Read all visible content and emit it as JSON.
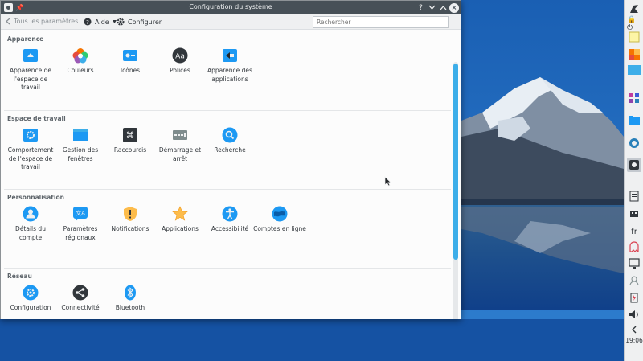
{
  "window": {
    "title": "Configuration du système"
  },
  "toolbar": {
    "back_label": "Tous les paramètres",
    "help_label": "Aide",
    "configure_label": "Configurer",
    "search_placeholder": "Rechercher"
  },
  "sections": [
    {
      "title": "Apparence",
      "items": [
        {
          "label": "Apparence de l'espace de travail",
          "icon": "workspace-appearance-icon"
        },
        {
          "label": "Couleurs",
          "icon": "colors-icon"
        },
        {
          "label": "Icônes",
          "icon": "icons-icon"
        },
        {
          "label": "Polices",
          "icon": "fonts-icon"
        },
        {
          "label": "Apparence des applications",
          "icon": "application-style-icon"
        }
      ]
    },
    {
      "title": "Espace de travail",
      "items": [
        {
          "label": "Comportement de l'espace de travail",
          "icon": "workspace-behavior-icon"
        },
        {
          "label": "Gestion des fenêtres",
          "icon": "window-management-icon"
        },
        {
          "label": "Raccourcis",
          "icon": "shortcuts-icon"
        },
        {
          "label": "Démarrage et arrêt",
          "icon": "startup-shutdown-icon"
        },
        {
          "label": "Recherche",
          "icon": "search-icon"
        }
      ]
    },
    {
      "title": "Personnalisation",
      "items": [
        {
          "label": "Détails du compte",
          "icon": "account-icon"
        },
        {
          "label": "Paramètres régionaux",
          "icon": "regional-settings-icon"
        },
        {
          "label": "Notifications",
          "icon": "notifications-icon"
        },
        {
          "label": "Applications",
          "icon": "applications-star-icon"
        },
        {
          "label": "Accessibilité",
          "icon": "accessibility-icon"
        },
        {
          "label": "Comptes en ligne",
          "icon": "online-accounts-icon"
        }
      ]
    },
    {
      "title": "Réseau",
      "items": [
        {
          "label": "Configuration",
          "icon": "network-configuration-icon"
        },
        {
          "label": "Connectivité",
          "icon": "connectivity-icon"
        },
        {
          "label": "Bluetooth",
          "icon": "bluetooth-icon"
        }
      ]
    }
  ],
  "panel": {
    "language": "fr",
    "clock": "19:06"
  },
  "colors": {
    "accent": "#3daee9",
    "titlebar": "#475057"
  }
}
